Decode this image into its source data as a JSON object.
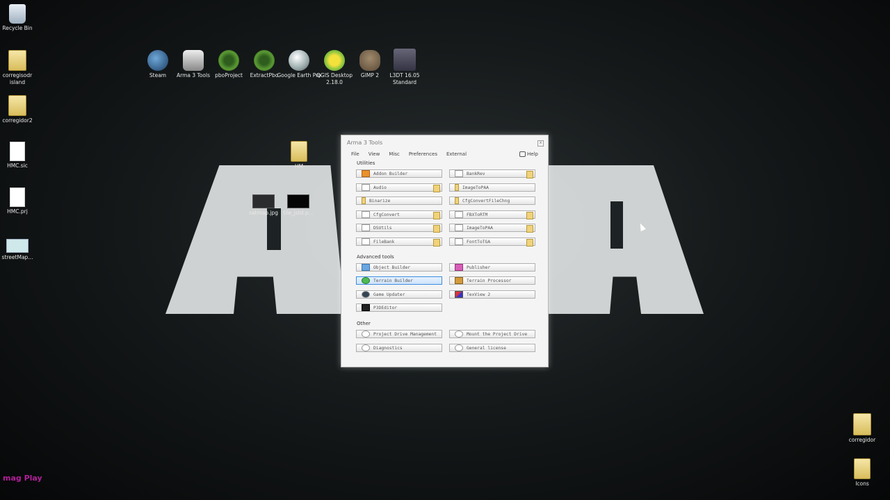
{
  "desktop": {
    "left_icons": [
      {
        "label": "Recycle Bin",
        "icon": "recycle-bin-icon"
      },
      {
        "label": "corregisodr island",
        "icon": "folder-icon"
      },
      {
        "label": "corregidor2",
        "icon": "folder-icon"
      },
      {
        "label": "HMC.sic",
        "icon": "document-icon"
      },
      {
        "label": "HMC.prj",
        "icon": "document-icon"
      },
      {
        "label": "streetMap...",
        "icon": "image-icon"
      }
    ],
    "top_apps": [
      {
        "label": "Steam",
        "icon": "steam-icon"
      },
      {
        "label": "Arma 3 Tools",
        "icon": "arma3-tools-icon"
      },
      {
        "label": "pboProject",
        "icon": "gear-icon"
      },
      {
        "label": "ExtractPbo",
        "icon": "gear-icon"
      },
      {
        "label": "Google Earth Pro",
        "icon": "google-earth-icon"
      },
      {
        "label": "QGIS Desktop 2.18.0",
        "icon": "qgis-icon"
      },
      {
        "label": "GIMP 2",
        "icon": "gimp-icon"
      },
      {
        "label": "L3DT 16.05 Standard",
        "icon": "l3dt-icon"
      }
    ],
    "middle_icons": [
      {
        "label": "HM",
        "icon": "folder-icon"
      },
      {
        "label": "satmap.jpg",
        "icon": "image-icon"
      },
      {
        "label": "tile_jstd.p...",
        "icon": "image-icon"
      }
    ],
    "right_icons": [
      {
        "label": "corregidor",
        "icon": "folder-icon"
      },
      {
        "label": "Icons",
        "icon": "folder-icon"
      }
    ],
    "watermark": "mag Play"
  },
  "window": {
    "title": "Arma 3 Tools",
    "close": "x",
    "menu": [
      "File",
      "View",
      "Misc",
      "Preferences",
      "External"
    ],
    "help": "Help",
    "sections": {
      "utilities": "Utilities",
      "advanced": "Advanced tools",
      "other": "Other"
    },
    "utilities_left": [
      "Addon Builder",
      "Audio",
      "Binarize",
      "CfgConvert",
      "DSUtils",
      "FileBank"
    ],
    "utilities_right": [
      "BankRev",
      "ImageToPAA",
      "CfgConvertFileChng",
      "FBXToRTM",
      "ImageToPAA",
      "FontToTGA"
    ],
    "advanced_left": [
      "Object Builder",
      "Terrain Builder",
      "Game Updater",
      "P3DEditor"
    ],
    "advanced_right": [
      "Publisher",
      "Terrain Processor",
      "TexView 2"
    ],
    "other_left": [
      "Project Drive Management",
      "Diagnostics"
    ],
    "other_right": [
      "Mount the Project Drive",
      "General license"
    ]
  }
}
